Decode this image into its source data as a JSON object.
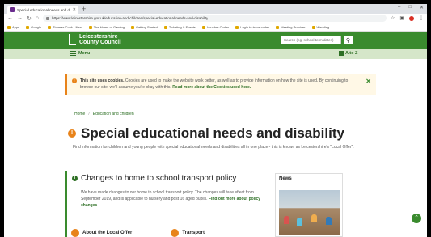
{
  "browser": {
    "tab_title": "Special educational needs and d",
    "url": "https://www.leicestershire.gov.uk/education-and-children/special-educational-needs-and-disability",
    "bookmarks": [
      "Apps",
      "Google",
      "Thomas Cook - Next",
      "The Home of Gaming",
      "Getting Started",
      "Ticketing & Events",
      "Voucher Codes",
      "Login to trace codes",
      "Meeting Provider",
      "Wedding"
    ]
  },
  "site": {
    "logo_line1": "Leicestershire",
    "logo_line2": "County Council",
    "search_placeholder": "Search (eg. school term dates)",
    "menu_label": "Menu",
    "atoz_label": "A to Z"
  },
  "cookie": {
    "bold": "This site uses cookies.",
    "text": " Cookies are used to make the website work better, as well as to provide information on how the site is used. By continuing to browse our site, we'll assume you're okay with this. ",
    "link": "Read more about the Cookies used here."
  },
  "breadcrumb": {
    "home": "Home",
    "section": "Education and children"
  },
  "page": {
    "title": "Special educational needs and disability",
    "intro": "Find information for children and young people with special educational needs and disabilities all in one place - this is known as Leicestershire's \"Local Offer\"."
  },
  "policy": {
    "title": "Changes to home to school transport policy",
    "text": "We have made changes to our home to school transport policy. The changes will take effect from September 2019, and is applicable to nursery and post 16 aged pupils. ",
    "link": "Find out more about policy changes"
  },
  "news": {
    "title": "News"
  },
  "cards": [
    "About the Local Offer",
    "Transport"
  ],
  "colors": {
    "brand_green": "#3a8b2e",
    "accent_orange": "#e8831a"
  }
}
